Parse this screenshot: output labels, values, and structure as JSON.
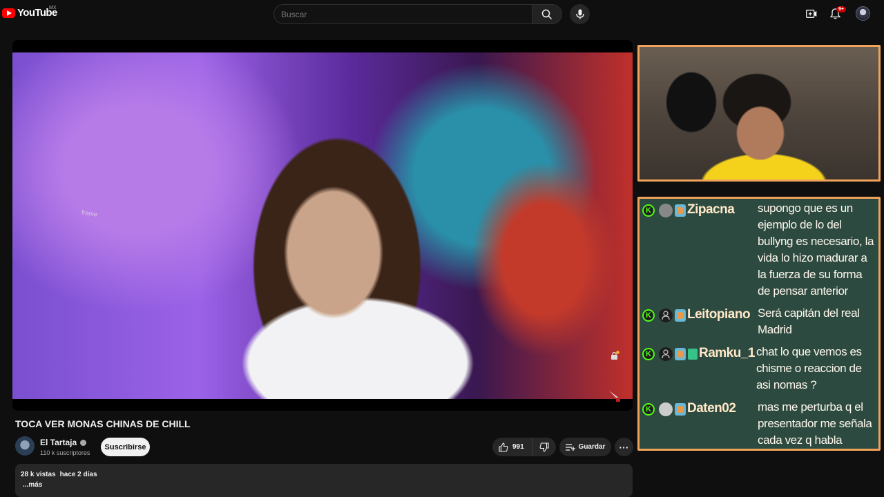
{
  "header": {
    "logo_text": "YouTube",
    "country_code": "MX",
    "search_placeholder": "Buscar",
    "notifications_count": "9+"
  },
  "video": {
    "overlay_text": "frame",
    "title": "TOCA VER MONAS CHINAS DE CHILL"
  },
  "channel": {
    "name": "El Tartaja",
    "subscribers": "110 k suscriptores",
    "subscribe_label": "Suscribirse"
  },
  "actions": {
    "likes": "991",
    "save_label": "Guardar",
    "more_label": "···"
  },
  "description": {
    "views": "28 k vistas",
    "date": "hace 2 días",
    "more": "...más"
  },
  "chat": {
    "messages": [
      {
        "user": "Zipacna",
        "text": "supongo que es un ejemplo de lo del bullyng es necesario, la vida lo hizo madurar a la fuerza de su forma de pensar anterior"
      },
      {
        "user": "Leitopiano",
        "text": "Será capitán del real Madrid"
      },
      {
        "user": "Ramku_1",
        "text": "chat lo que vemos es chisme o reaccion de asi nomas ?"
      },
      {
        "user": "Daten02",
        "text": "mas me perturba q el presentador me señala cada vez q habla"
      }
    ]
  },
  "colors": {
    "accent_red": "#ff0000",
    "chat_border": "#f0a35a",
    "chat_bg": "#2d4a40",
    "kick_green": "#53fc18"
  },
  "icons": [
    "youtube-logo-icon",
    "search-icon",
    "mic-icon",
    "create-icon",
    "bell-icon",
    "like-icon",
    "dislike-icon",
    "save-icon"
  ]
}
